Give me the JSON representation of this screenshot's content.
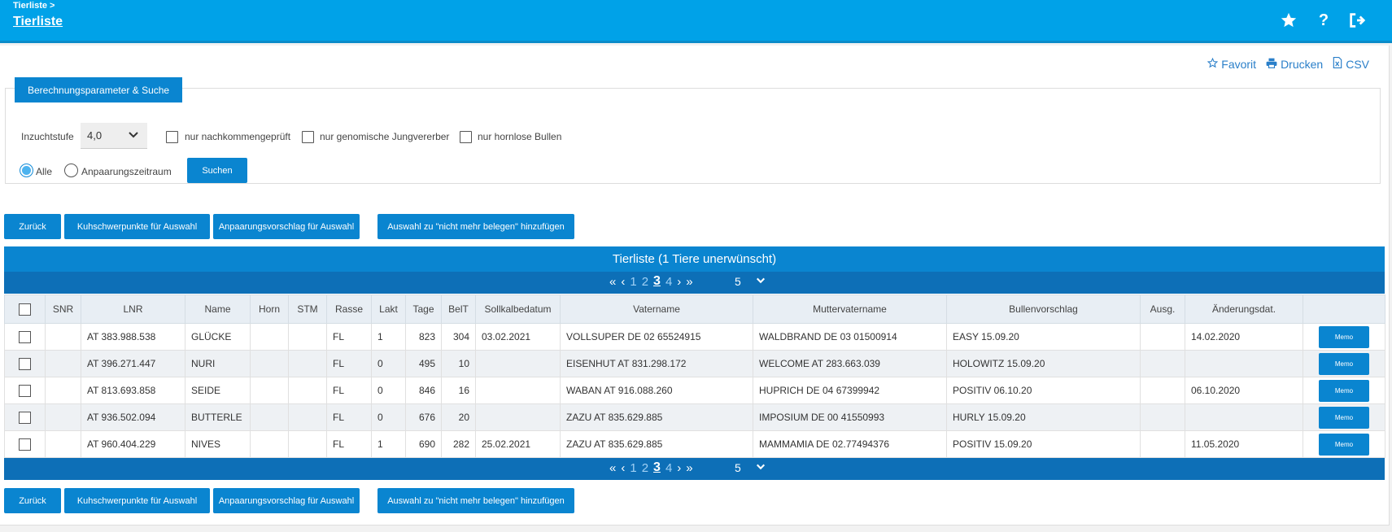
{
  "header": {
    "breadcrumb": "Tierliste >",
    "title": "Tierliste",
    "icons": [
      "star-icon",
      "help-icon",
      "logout-icon"
    ]
  },
  "toolbar": {
    "favorit": "Favorit",
    "drucken": "Drucken",
    "csv": "CSV"
  },
  "search": {
    "tab_label": "Berechnungsparameter & Suche",
    "inzucht_label": "Inzuchtstufe",
    "inzucht_value": "4,0",
    "cb_nachkommen": "nur nachkommengeprüft",
    "cb_genomisch": "nur genomische Jungvererber",
    "cb_hornlos": "nur hornlose Bullen",
    "radio_alle": "Alle",
    "radio_anpaarung": "Anpaarungszeitraum",
    "radio_selected": "Alle",
    "submit": "Suchen"
  },
  "actions": {
    "zurueck": "Zurück",
    "kuhschwerpunkte": "Kuhschwerpunkte für Auswahl",
    "anpaarungsvorschlag": "Anpaarungsvorschlag für Auswahl",
    "nicht_mehr": "Auswahl zu \"nicht mehr belegen\" hinzufügen"
  },
  "table": {
    "title": "Tierliste (1 Tiere unerwünscht)",
    "pages": [
      "1",
      "2",
      "3",
      "4"
    ],
    "current_page": "3",
    "page_size": "5",
    "columns": [
      "SNR",
      "LNR",
      "Name",
      "Horn",
      "STM",
      "Rasse",
      "Lakt",
      "Tage",
      "BelT",
      "Sollkalbedatum",
      "Vatername",
      "Muttervatername",
      "Bullenvorschlag",
      "Ausg.",
      "Änderungsdat."
    ],
    "memo_label": "Memo",
    "rows": [
      {
        "snr": "",
        "lnr": "AT 383.988.538",
        "name": "GLÜCKE",
        "horn": "",
        "stm": "",
        "rasse": "FL",
        "lakt": "1",
        "tage": "823",
        "belt": "304",
        "soll": "03.02.2021",
        "vater": "VOLLSUPER DE 02 65524915",
        "mv": "WALDBRAND DE 03 01500914",
        "bull": "EASY 15.09.20",
        "ausg": "",
        "aend": "14.02.2020"
      },
      {
        "snr": "",
        "lnr": "AT 396.271.447",
        "name": "NURI",
        "horn": "",
        "stm": "",
        "rasse": "FL",
        "lakt": "0",
        "tage": "495",
        "belt": "10",
        "soll": "",
        "vater": "EISENHUT AT 831.298.172",
        "mv": "WELCOME AT 283.663.039",
        "bull": "HOLOWITZ 15.09.20",
        "ausg": "",
        "aend": ""
      },
      {
        "snr": "",
        "lnr": "AT 813.693.858",
        "name": "SEIDE",
        "horn": "",
        "stm": "",
        "rasse": "FL",
        "lakt": "0",
        "tage": "846",
        "belt": "16",
        "soll": "",
        "vater": "WABAN AT 916.088.260",
        "mv": "HUPRICH DE 04 67399942",
        "bull": "POSITIV 06.10.20",
        "ausg": "",
        "aend": "06.10.2020"
      },
      {
        "snr": "",
        "lnr": "AT 936.502.094",
        "name": "BUTTERLE",
        "horn": "",
        "stm": "",
        "rasse": "FL",
        "lakt": "0",
        "tage": "676",
        "belt": "20",
        "soll": "",
        "vater": "ZAZU AT 835.629.885",
        "mv": "IMPOSIUM DE 00 41550993",
        "bull": "HURLY 15.09.20",
        "ausg": "",
        "aend": ""
      },
      {
        "snr": "",
        "lnr": "AT 960.404.229",
        "name": "NIVES",
        "horn": "",
        "stm": "",
        "rasse": "FL",
        "lakt": "1",
        "tage": "690",
        "belt": "282",
        "soll": "25.02.2021",
        "vater": "ZAZU AT 835.629.885",
        "mv": "MAMMAMIA DE 02.77494376",
        "bull": "POSITIV 15.09.20",
        "ausg": "",
        "aend": "11.05.2020"
      }
    ]
  },
  "colors": {
    "header_bg": "#00a2e8",
    "button_bg": "#0a85d0",
    "pager_bg": "#0d6fb7",
    "link": "#2a7fc9"
  }
}
